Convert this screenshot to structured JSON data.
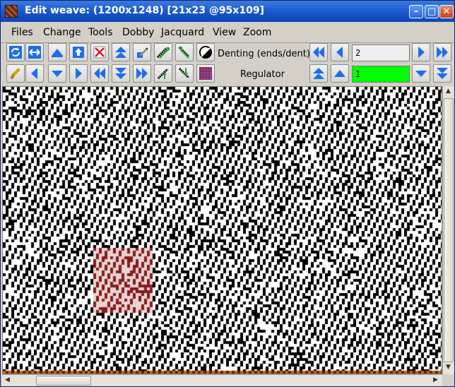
{
  "window": {
    "title": "Edit weave:  (1200x1248) [21x23 @95x109]",
    "controls": {
      "minimize": "–",
      "maximize": "□",
      "close": "✕"
    }
  },
  "menu": [
    "Files",
    "Change",
    "Tools",
    "Dobby",
    "Jacquard",
    "View",
    "Zoom"
  ],
  "toolbar": {
    "denting_label": "Denting (ends/dent)",
    "denting_value": "2",
    "regulator_label": "Regulator",
    "regulator_value": "1",
    "regulator_bg": "#00ff00"
  },
  "icons": {
    "row1": [
      "refresh-icon",
      "resize-horizontal-icon",
      "shift-up-icon",
      "upload-icon",
      "clear-cross-icon",
      "double-up-icon",
      "pen-pattern-icon",
      "twill-right-icon",
      "twill-left-icon",
      "invert-icon"
    ],
    "row2": [
      "brush-icon",
      "arrow-left-icon",
      "arrow-down-icon",
      "arrow-right-icon",
      "double-left-icon",
      "double-down-icon",
      "double-right-icon",
      "twill-up-icon",
      "twill-down-icon",
      "grid-color-icon"
    ]
  },
  "colors": {
    "accent": "#1553c9",
    "tool_arrow": "#1d6ee8",
    "selection": "#8b1a1a",
    "warp": "#000000",
    "weft": "#ffffff"
  }
}
